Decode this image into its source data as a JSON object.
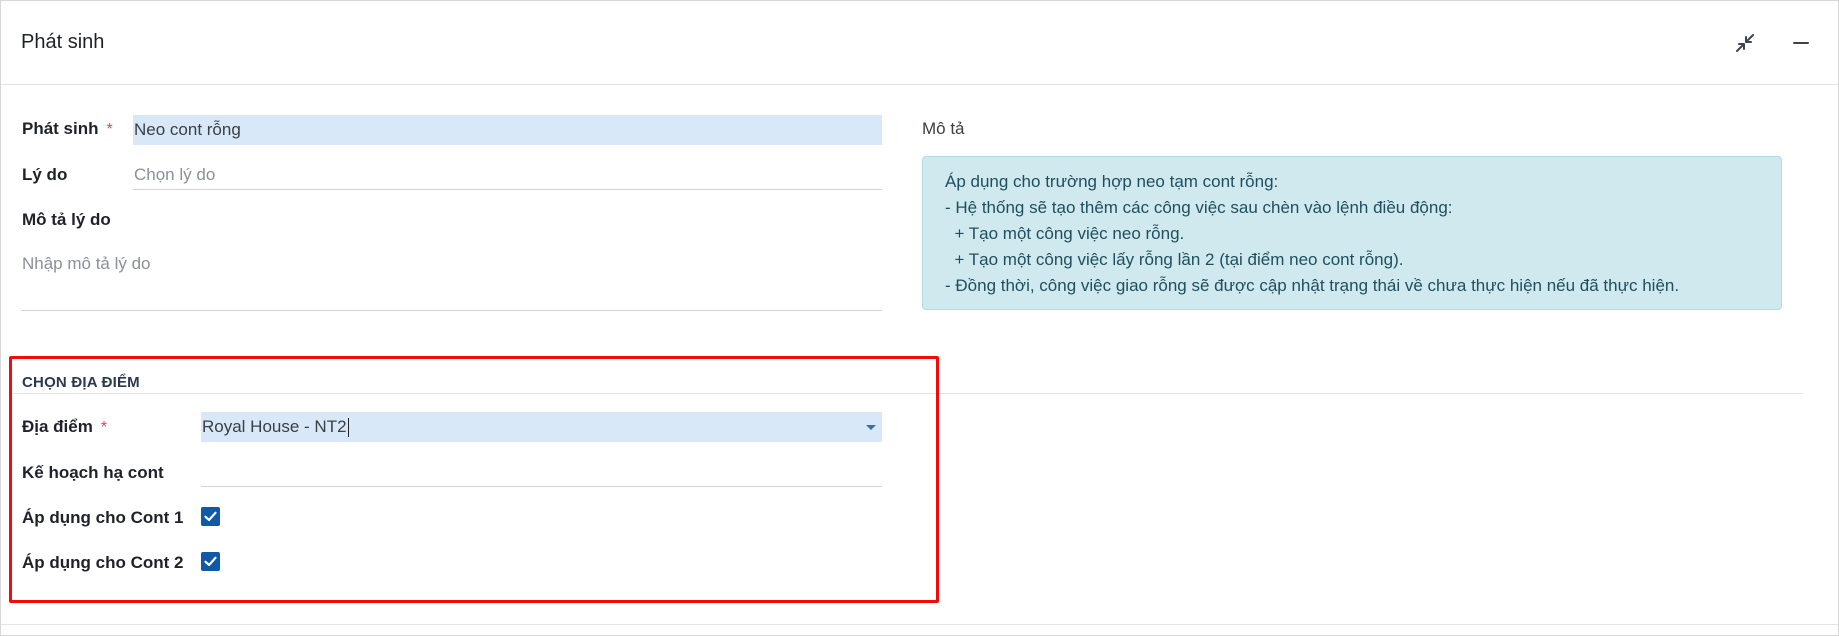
{
  "dialog": {
    "title": "Phát sinh"
  },
  "form": {
    "phat_sinh": {
      "label": "Phát sinh",
      "required_mark": "*",
      "value": "Neo cont rỗng"
    },
    "ly_do": {
      "label": "Lý do",
      "placeholder": "Chọn lý do"
    },
    "mo_ta_ly_do": {
      "label": "Mô tả lý do",
      "placeholder": "Nhập mô tả lý do"
    }
  },
  "description": {
    "label": "Mô tả",
    "lines": [
      "Áp dụng cho trường hợp neo tạm cont rỗng:",
      "- Hệ thống sẽ tạo thêm các công việc sau chèn vào lệnh điều động:",
      "  + Tạo một công việc neo rỗng.",
      "  + Tạo một công việc lấy rỗng lần 2 (tại điểm neo cont rỗng).",
      "- Đồng thời, công việc giao rỗng sẽ được cập nhật trạng thái về chưa thực hiện nếu đã thực hiện."
    ]
  },
  "location_section": {
    "title": "CHỌN ĐỊA ĐIỂM",
    "dia_diem": {
      "label": "Địa điểm",
      "required_mark": "*",
      "value": "Royal House - NT2"
    },
    "ke_hoach": {
      "label": "Kế hoạch hạ cont",
      "value": ""
    },
    "cont1": {
      "label": "Áp dụng cho Cont 1",
      "checked": true
    },
    "cont2": {
      "label": "Áp dụng cho Cont 2",
      "checked": true
    }
  },
  "colors": {
    "highlight": "#f10c0c",
    "checkbox": "#0f5aa8",
    "filled_field": "#d9e8f8",
    "info_box": "#cfe9ef"
  },
  "icons": {
    "collapse": "collapse-arrows-icon",
    "minimize": "minus-icon",
    "check": "checkmark-icon",
    "dropdown": "caret-down-icon"
  }
}
